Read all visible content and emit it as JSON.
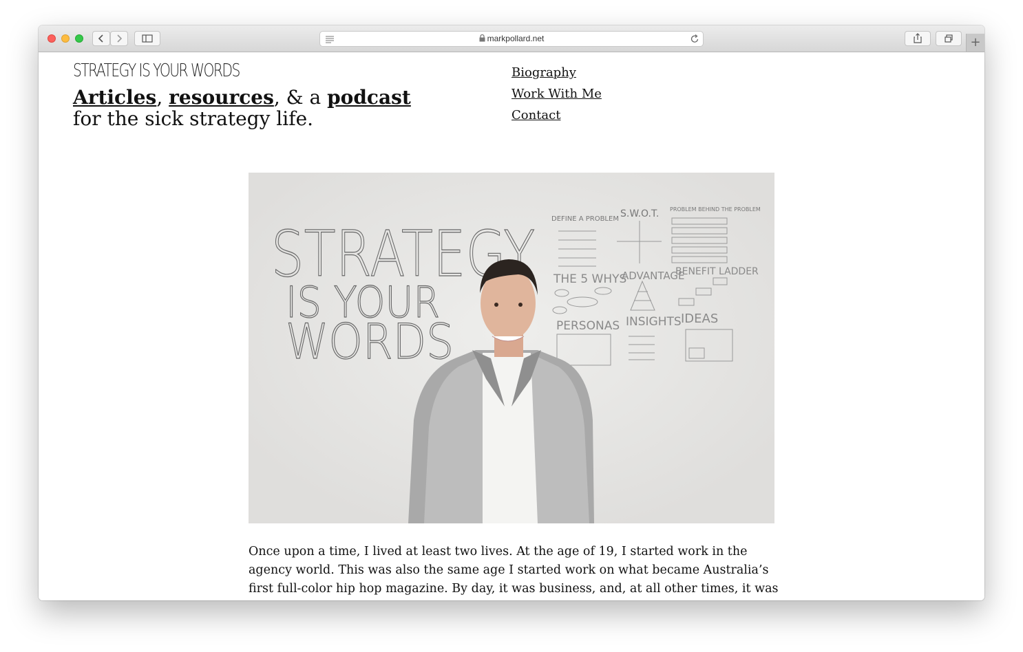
{
  "browser": {
    "url": "markpollard.net"
  },
  "site": {
    "logo_text": "STRATEGY IS YOUR WORDS",
    "tagline": {
      "link1": "Articles",
      "sep1": ", ",
      "link2": "resources",
      "sep2": ", & a ",
      "link3": "podcast",
      "line2": "for the sick strategy life."
    },
    "nav": [
      {
        "label": "Biography"
      },
      {
        "label": "Work With Me"
      },
      {
        "label": "Contact"
      }
    ]
  },
  "hero": {
    "board_big_text": [
      "STRATEGY",
      "IS YOUR",
      "WORDS"
    ],
    "board_small_labels": [
      "DEFINE A PROBLEM",
      "S.W.O.T.",
      "PROBLEM BEHIND THE PROBLEM",
      "THE 5 WHYS",
      "ADVANTAGE",
      "BENEFIT LADDER",
      "PERSONAS",
      "INSIGHTS",
      "IDEAS"
    ]
  },
  "article": {
    "paragraph": "Once upon a time, I lived at least two lives. At the age of 19, I started work in the agency world. This was also the same age I started work on what became Australia’s first full-color hip hop magazine. By day, it was business, and, at all other times, it was hip hop. I didn’t"
  }
}
